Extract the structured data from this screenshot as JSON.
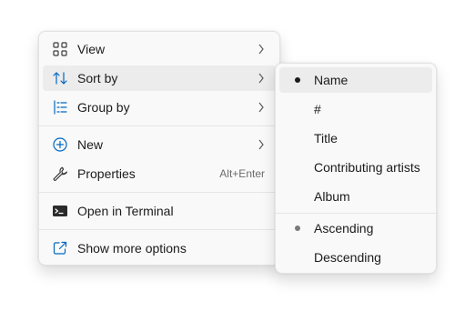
{
  "main_menu": {
    "items": [
      {
        "label": "View",
        "icon": "view-grid-icon",
        "has_submenu": true
      },
      {
        "label": "Sort by",
        "icon": "sort-icon",
        "has_submenu": true
      },
      {
        "label": "Group by",
        "icon": "group-list-icon",
        "has_submenu": true
      },
      {
        "label": "New",
        "icon": "plus-circle-icon",
        "has_submenu": true
      },
      {
        "label": "Properties",
        "icon": "wrench-icon",
        "shortcut": "Alt+Enter"
      },
      {
        "label": "Open in Terminal",
        "icon": "terminal-icon"
      },
      {
        "label": "Show more options",
        "icon": "expand-arrow-icon"
      }
    ]
  },
  "sort_submenu": {
    "fields": [
      {
        "label": "Name",
        "selected": true
      },
      {
        "label": "#",
        "selected": false
      },
      {
        "label": "Title",
        "selected": false
      },
      {
        "label": "Contributing artists",
        "selected": false
      },
      {
        "label": "Album",
        "selected": false
      }
    ],
    "order": [
      {
        "label": "Ascending",
        "selected": true
      },
      {
        "label": "Descending",
        "selected": false
      }
    ]
  },
  "colors": {
    "accent_blue": "#0067c0",
    "menu_bg": "#f9f9f9",
    "hover_bg": "#ececec"
  }
}
